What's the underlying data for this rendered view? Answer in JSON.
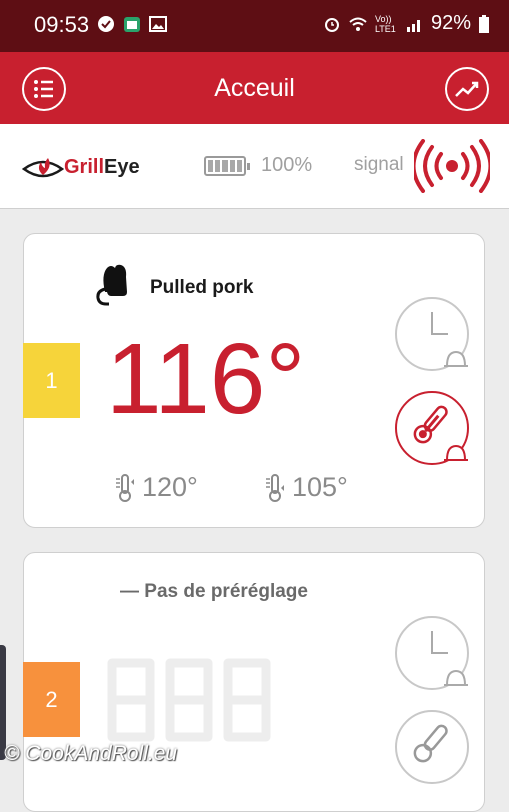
{
  "status_bar": {
    "time": "09:53",
    "signal_label": "Vo)) LTE1",
    "battery": "92%"
  },
  "app_bar": {
    "title": "Acceuil"
  },
  "brand": {
    "logo_grill": "Grill",
    "logo_eye": "Eye",
    "battery_pct": "100%",
    "signal_label": "signal"
  },
  "probes": [
    {
      "number": "1",
      "name": "Pulled pork",
      "temperature": "116°",
      "target_high": "120°",
      "target_low": "105°",
      "tab_color": "#f6d43a"
    },
    {
      "number": "2",
      "name": "— Pas de préréglage",
      "temperature": "888",
      "tab_color": "#f7913d"
    }
  ],
  "watermark": "© CookAndRoll.eu",
  "colors": {
    "primary": "#c8202f",
    "status_bar": "#5e0e14",
    "grey_text": "#8a8a8a"
  }
}
